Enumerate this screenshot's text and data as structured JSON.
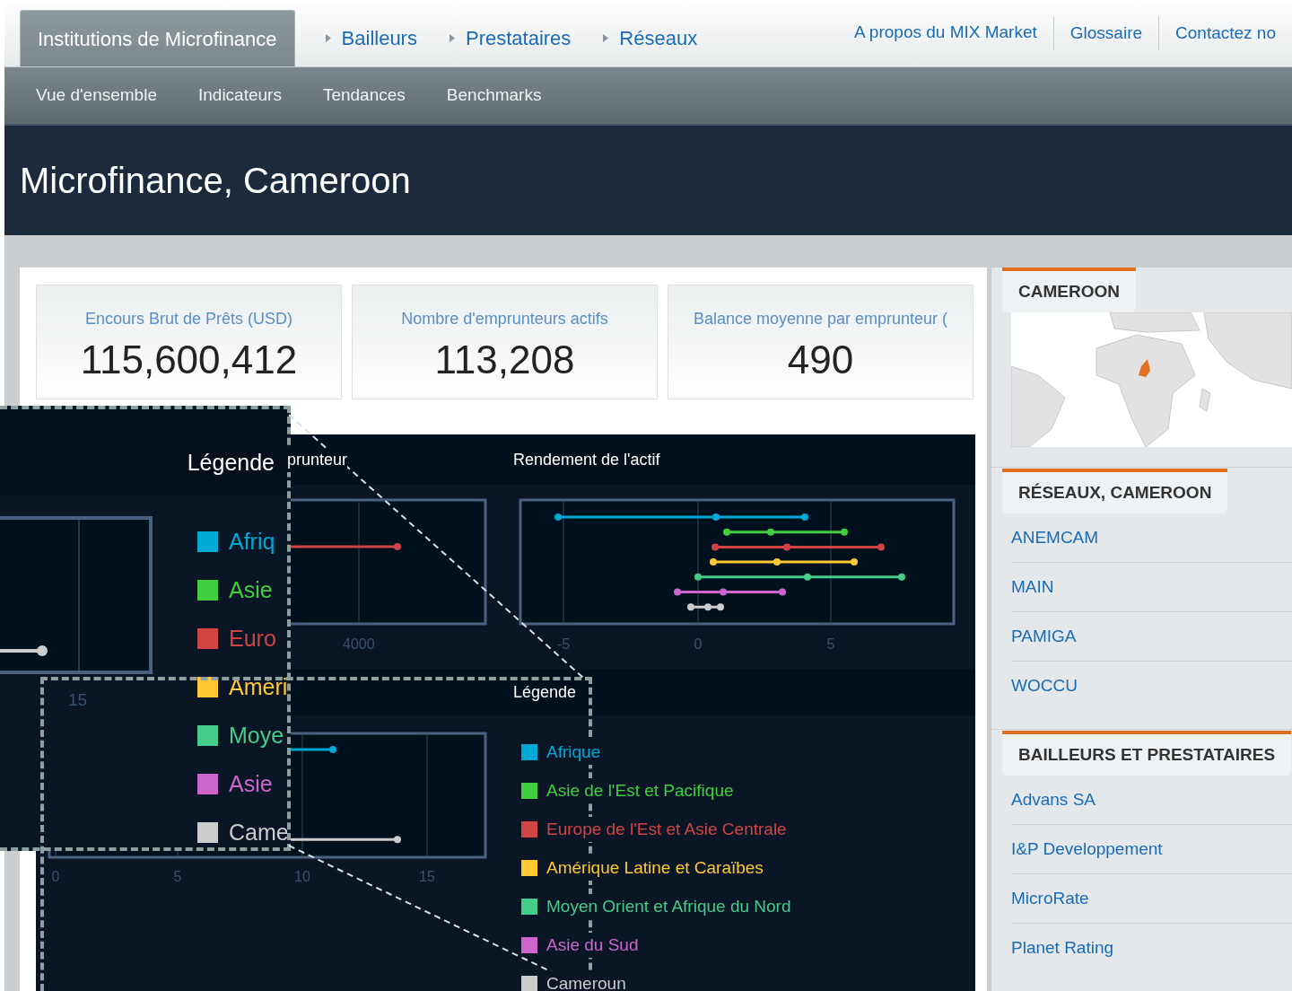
{
  "nav": {
    "tabs": [
      {
        "label": "Institutions de Microfinance",
        "selected": true
      },
      {
        "label": "Bailleurs",
        "selected": false
      },
      {
        "label": "Prestataires",
        "selected": false
      },
      {
        "label": "Réseaux",
        "selected": false
      }
    ],
    "links": [
      "A propos du MIX Market",
      "Glossaire",
      "Contactez no"
    ]
  },
  "subnav": [
    "Vue d'ensemble",
    "Indicateurs",
    "Tendances",
    "Benchmarks"
  ],
  "page_title": "Microfinance, Cameroon",
  "kpis": [
    {
      "label": "Encours Brut de Prêts (USD)",
      "value": "115,600,412"
    },
    {
      "label": "Nombre d'emprunteurs actifs",
      "value": "113,208"
    },
    {
      "label": "Balance moyenne par emprunteur (",
      "value": "490"
    }
  ],
  "charts": {
    "partial": {
      "title": "prunteur",
      "tick": "4000"
    },
    "roa": {
      "title": "Rendement de l'actif",
      "ticks": [
        "-5",
        "0",
        "5"
      ]
    },
    "lower": {
      "ticks": [
        "0",
        "5",
        "10",
        "15"
      ]
    },
    "legend": {
      "title": "Légende",
      "items": [
        {
          "label": "Afrique",
          "color": "#00a9d4"
        },
        {
          "label": "Asie de l'Est et Pacifique",
          "color": "#3fcf3f"
        },
        {
          "label": "Europe de l'Est et Asie Centrale",
          "color": "#d04444"
        },
        {
          "label": "Amérique Latine et Caraïbes",
          "color": "#ffc933"
        },
        {
          "label": "Moyen Orient et Afrique du Nord",
          "color": "#44cc88"
        },
        {
          "label": "Asie du Sud",
          "color": "#cc66cc"
        },
        {
          "label": "Cameroun",
          "color": "#cccccc"
        }
      ]
    }
  },
  "inset": {
    "title": "Légende",
    "tick": "15",
    "items": [
      {
        "label": "Afriq",
        "color": "#00a9d4"
      },
      {
        "label": "Asie",
        "color": "#3fcf3f"
      },
      {
        "label": "Euro",
        "color": "#d04444"
      },
      {
        "label": "Améri",
        "color": "#ffc933"
      },
      {
        "label": "Moye",
        "color": "#44cc88"
      },
      {
        "label": "Asie",
        "color": "#cc66cc"
      },
      {
        "label": "Came",
        "color": "#cccccc"
      }
    ]
  },
  "sidebar": {
    "map_title": "CAMEROON",
    "sections": [
      {
        "title": "RÉSEAUX, CAMEROON",
        "items": [
          "ANEMCAM",
          "MAIN",
          "PAMIGA",
          "WOCCU"
        ]
      },
      {
        "title": "BAILLEURS ET PRESTATAIRES",
        "items": [
          "Advans SA",
          "I&P Developpement",
          "MicroRate",
          "Planet Rating"
        ]
      }
    ]
  }
}
